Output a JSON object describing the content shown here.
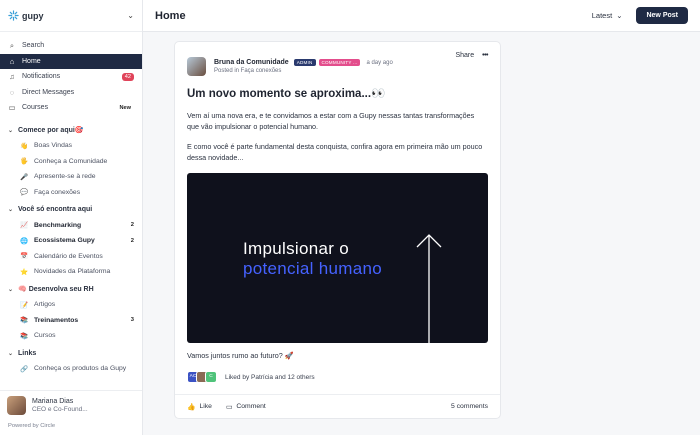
{
  "brand": {
    "name": "gupy",
    "accent": "#3aa0d8"
  },
  "sidebar": {
    "nav": [
      {
        "label": "Search",
        "icon": "search-icon"
      },
      {
        "label": "Home",
        "icon": "home-icon",
        "active": true
      },
      {
        "label": "Notifications",
        "icon": "bell-icon",
        "badge": "42"
      },
      {
        "label": "Direct Messages",
        "icon": "chat-icon"
      },
      {
        "label": "Courses",
        "icon": "book-icon",
        "badge": "New"
      }
    ],
    "sections": [
      {
        "title": "Comece por aqui🎯",
        "items": [
          {
            "emoji": "👋",
            "label": "Boas Vindas"
          },
          {
            "emoji": "🖐",
            "label": "Conheça a Comunidade"
          },
          {
            "emoji": "🎤",
            "label": "Apresente-se à rede"
          },
          {
            "emoji": "💬",
            "label": "Faça conexões"
          }
        ]
      },
      {
        "title": "Você só encontra aqui",
        "items": [
          {
            "emoji": "📈",
            "label": "Benchmarking",
            "count": "2",
            "bold": true
          },
          {
            "emoji": "🌐",
            "label": "Ecossistema Gupy",
            "count": "2",
            "bold": true
          },
          {
            "emoji": "📅",
            "label": "Calendário de Eventos"
          },
          {
            "emoji": "⭐",
            "label": "Novidades da Plataforma"
          }
        ]
      },
      {
        "title": "🧠 Desenvolva seu RH",
        "items": [
          {
            "emoji": "📝",
            "label": "Artigos"
          },
          {
            "emoji": "📚",
            "label": "Treinamentos",
            "count": "3",
            "bold": true
          },
          {
            "emoji": "📚",
            "label": "Cursos"
          }
        ]
      },
      {
        "title": "Links",
        "items": [
          {
            "emoji": "🔗",
            "label": "Conheça os produtos da Gupy"
          }
        ]
      }
    ],
    "profile": {
      "name": "Mariana Dias",
      "role": "CEO e Co-Found..."
    },
    "powered": "Powered by Circle"
  },
  "topbar": {
    "title": "Home",
    "sort": "Latest",
    "new_post": "New Post"
  },
  "post": {
    "author": "Bruna da Comunidade",
    "tag_admin": "ADMIN",
    "tag_community": "COMMUNITY ...",
    "time": "a day ago",
    "posted_in": "Posted in Faça conexões",
    "share": "Share",
    "title": "Um novo momento se aproxima...👀",
    "p1": "Vem aí uma nova era, e te convidamos a estar com a Gupy nessas tantas transformações que vão impulsionar o potencial humano.",
    "p2": "E como você é parte fundamental desta conquista, confira agora em primeira mão um pouco dessa novidade...",
    "hero_line1": "Impulsionar o",
    "hero_line2": "potencial humano",
    "caption": "Vamos juntos rumo ao futuro? 🚀",
    "likers": [
      "AC",
      "",
      "C"
    ],
    "likes_text": "Liked by Patrícia and 12 others",
    "like": "Like",
    "comment": "Comment",
    "comments_count": "5 comments"
  }
}
